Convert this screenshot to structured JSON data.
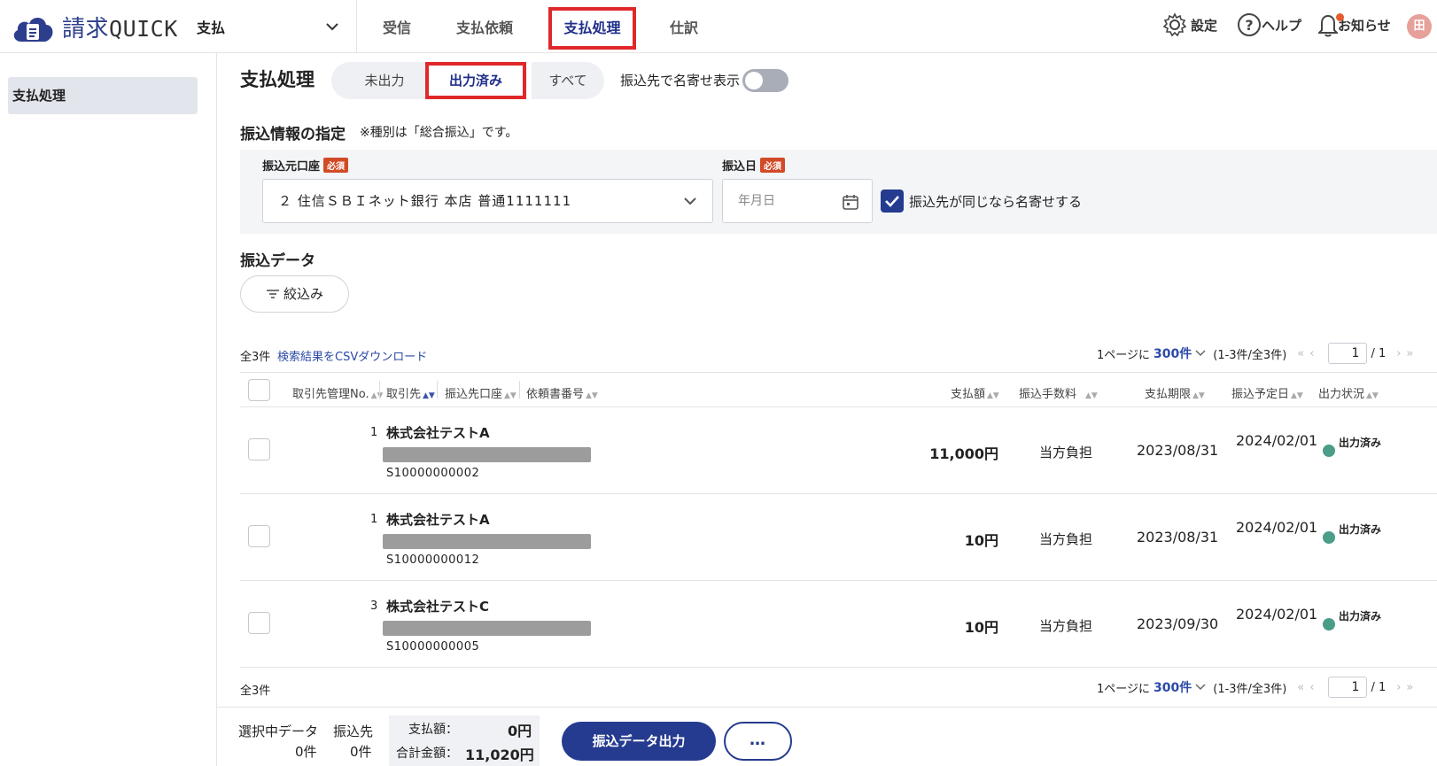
{
  "header": {
    "logo_text": "請求",
    "logo_quick": "QUICK",
    "module": "支払",
    "tabs": [
      "受信",
      "支払依頼",
      "支払処理",
      "仕訳"
    ],
    "settings": "設定",
    "help": "ヘルプ",
    "news": "お知らせ",
    "avatar": "田"
  },
  "sidebar": {
    "item": "支払処理"
  },
  "page": {
    "title": "支払処理",
    "segments": [
      "未出力",
      "出力済み",
      "すべて"
    ],
    "toggle_label": "振込先で名寄せ表示"
  },
  "transfer_info": {
    "title": "振込情報の指定",
    "note": "※種別は「総合振込」です。",
    "account_label": "振込元口座",
    "required": "必須",
    "account_value": "２ 住信ＳＢＩネット銀行 本店 普通1111111",
    "date_label": "振込日",
    "date_placeholder": "年月日",
    "merge_label": "振込先が同じなら名寄せする"
  },
  "data_section": {
    "title": "振込データ",
    "filter": "絞込み",
    "count": "全3件",
    "csv": "検索結果をCSVダウンロード",
    "pager_prefix": "1ページに",
    "per_page": "300件",
    "range": "(1-3件/全3件)",
    "page": "1",
    "total_pages": "/ 1"
  },
  "columns": {
    "partner_no": "取引先管理No.",
    "partner": "取引先",
    "account": "振込先口座",
    "doc_no": "依頼書番号",
    "amount": "支払額",
    "fee": "振込手数料",
    "due": "支払期限",
    "scheduled": "振込予定日",
    "status": "出力状況"
  },
  "rows": [
    {
      "no": "1",
      "name": "株式会社テストA",
      "doc": "S10000000002",
      "amount": "11,000円",
      "fee": "当方負担",
      "due": "2023/08/31",
      "scheduled": "2024/02/01",
      "status": "出力済み"
    },
    {
      "no": "1",
      "name": "株式会社テストA",
      "doc": "S10000000012",
      "amount": "10円",
      "fee": "当方負担",
      "due": "2023/08/31",
      "scheduled": "2024/02/01",
      "status": "出力済み"
    },
    {
      "no": "3",
      "name": "株式会社テストC",
      "doc": "S10000000005",
      "amount": "10円",
      "fee": "当方負担",
      "due": "2023/09/30",
      "scheduled": "2024/02/01",
      "status": "出力済み"
    }
  ],
  "footer": {
    "selected_label": "選択中データ",
    "selected_count": "0件",
    "payee_label": "振込先",
    "payee_count": "0件",
    "pay_label": "支払額：",
    "pay_value": "0円",
    "total_label": "合計金額：",
    "total_value": "11,020円",
    "output_button": "振込データ出力",
    "more": "…"
  }
}
